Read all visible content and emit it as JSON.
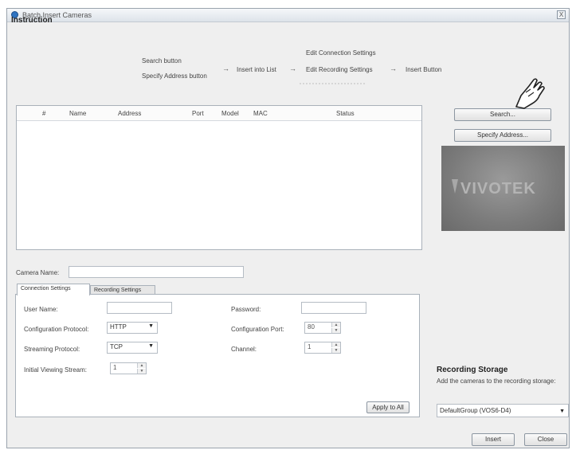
{
  "window": {
    "title": "Batch Insert Cameras",
    "close_label": "X"
  },
  "instruction": {
    "title": "Instruction",
    "step1_a": "Search button",
    "step1_b": "Specify Address button",
    "step2": "Insert into List",
    "step3_a": "Edit Connection Settings",
    "step3_b": "Edit Recording Settings",
    "step4": "Insert Button",
    "arrow": "→"
  },
  "list": {
    "columns": [
      "#",
      "Name",
      "Address",
      "Port",
      "Model",
      "MAC",
      "Status"
    ],
    "rows": []
  },
  "buttons": {
    "search": "Search...",
    "specify_address": "Specify Address...",
    "apply_to_all": "Apply to All",
    "insert": "Insert",
    "close": "Close"
  },
  "logo": {
    "text": "VIVOTEK"
  },
  "camera_name": {
    "label": "Camera Name:",
    "value": ""
  },
  "tabs": {
    "connection": "Connection Settings",
    "recording": "Recording Settings",
    "active": "connection"
  },
  "connection": {
    "user_name_label": "User Name:",
    "user_name_value": "",
    "password_label": "Password:",
    "password_value": "",
    "config_protocol_label": "Configuration Protocol:",
    "config_protocol_value": "HTTP",
    "config_port_label": "Configuration Port:",
    "config_port_value": "80",
    "streaming_protocol_label": "Streaming Protocol:",
    "streaming_protocol_value": "TCP",
    "channel_label": "Channel:",
    "channel_value": "1",
    "initial_stream_label": "Initial Viewing Stream:",
    "initial_stream_value": "1"
  },
  "storage": {
    "title": "Recording Storage",
    "description": "Add the cameras to the recording storage:",
    "selected": "DefaultGroup (VOS6-D4)"
  },
  "colors": {
    "window_bg": "#efefef",
    "accent_icon": "#2f73c0",
    "logo_bg": "#7b7b7b"
  }
}
